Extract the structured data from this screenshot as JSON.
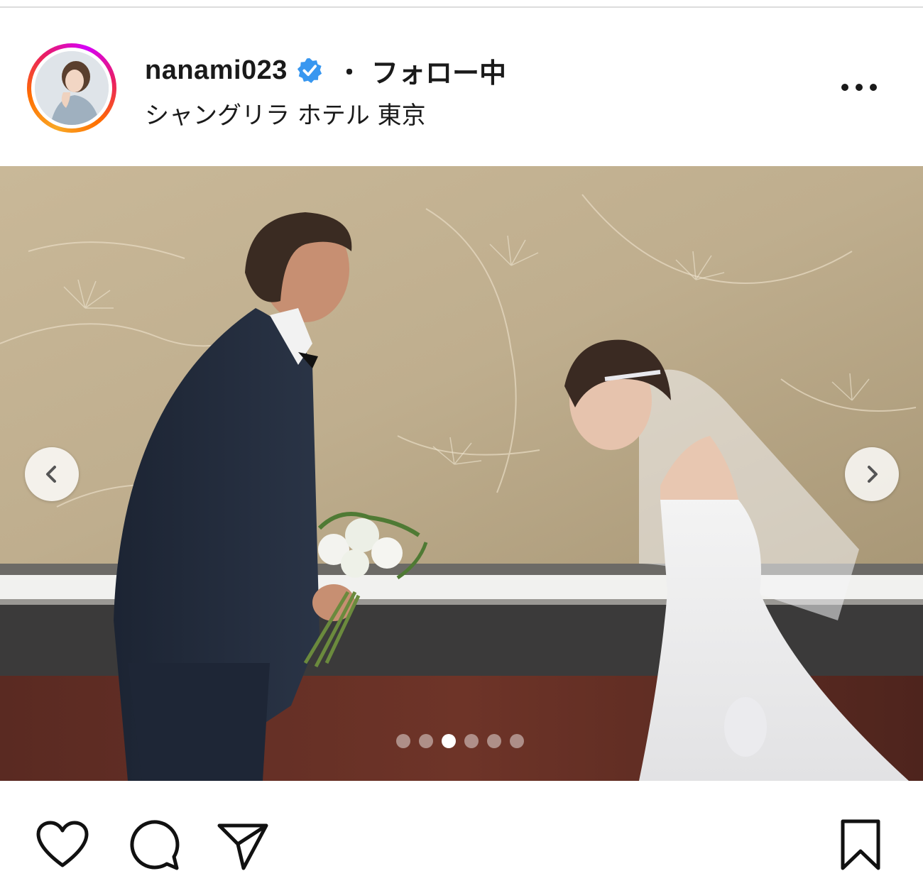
{
  "post_header": {
    "username": "nanami023",
    "separator": "・",
    "follow_status": "フォロー中",
    "location": "シャングリラ ホテル 東京",
    "verified": true,
    "avatar_ring_colors": [
      "#f9a825",
      "#ff6d00",
      "#e91e63",
      "#d500f9"
    ]
  },
  "media": {
    "prev_icon": "chevron-left-icon",
    "next_icon": "chevron-right-icon",
    "carousel_count": 6,
    "carousel_active_index": 2
  },
  "actions": {
    "like_icon": "heart-icon",
    "comment_icon": "comment-icon",
    "share_icon": "paper-plane-icon",
    "save_icon": "bookmark-icon"
  },
  "colors": {
    "verified_blue": "#3897f0",
    "text": "#1a1a1a"
  }
}
